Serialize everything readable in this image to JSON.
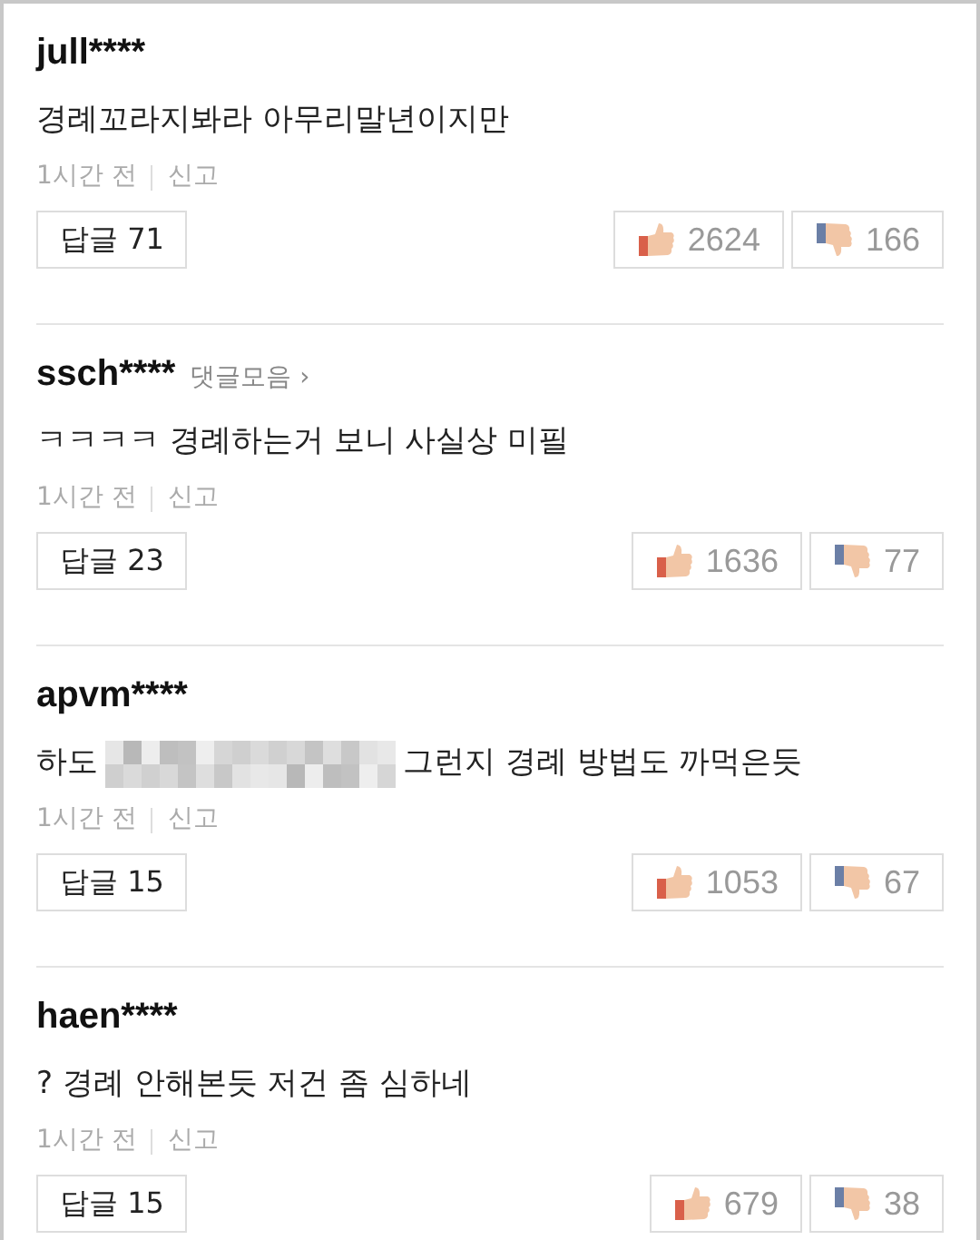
{
  "comments": [
    {
      "user": "jull****",
      "text_parts": [
        {
          "kind": "text",
          "text": "경례꼬라지봐라 아무리말년이지만"
        }
      ],
      "time": "1시간 전",
      "report": "신고",
      "reply": "답글 71",
      "likes": "2624",
      "dislikes": "166"
    },
    {
      "user": "ssch****",
      "collection_link": "댓글모음 ›",
      "text_parts": [
        {
          "kind": "text",
          "text": "ㅋㅋㅋㅋ 경례하는거 보니 사실상 미필"
        }
      ],
      "time": "1시간 전",
      "report": "신고",
      "reply": "답글 23",
      "likes": "1636",
      "dislikes": "77"
    },
    {
      "user": "apvm****",
      "text_parts": [
        {
          "kind": "text",
          "text": "하도"
        },
        {
          "kind": "mosaic"
        },
        {
          "kind": "text",
          "text": "그런지 경례 방법도 까먹은듯"
        }
      ],
      "time": "1시간 전",
      "report": "신고",
      "reply": "답글 15",
      "likes": "1053",
      "dislikes": "67"
    },
    {
      "user": "haen****",
      "text_parts": [
        {
          "kind": "text",
          "text": "? 경례 안해본듯 저건 좀 심하네"
        }
      ],
      "time": "1시간 전",
      "report": "신고",
      "reply": "답글 15",
      "likes": "679",
      "dislikes": "38"
    }
  ]
}
